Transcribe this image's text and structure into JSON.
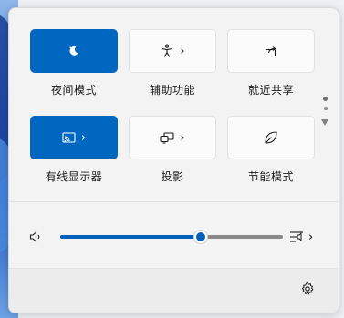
{
  "tiles": [
    {
      "label": "夜间模式",
      "state": "on",
      "icon": "night-light-icon"
    },
    {
      "label": "辅助功能",
      "state": "off",
      "icon": "accessibility-icon",
      "chevron": "›"
    },
    {
      "label": "就近共享",
      "state": "off",
      "icon": "nearby-share-icon"
    },
    {
      "label": "有线显示器",
      "state": "on",
      "icon": "cast-icon",
      "chevron": "›"
    },
    {
      "label": "投影",
      "state": "off",
      "icon": "project-icon",
      "chevron": "›"
    },
    {
      "label": "节能模式",
      "state": "off",
      "icon": "energy-saver-icon"
    }
  ],
  "volume": {
    "level": 0.63,
    "icon": "speaker-icon",
    "mixer_icon": "sound-output-icon",
    "mixer_chevron": "›"
  },
  "pager": {
    "pages": 2,
    "current": 1
  },
  "footer": {
    "settings_icon": "gear-icon"
  },
  "colors": {
    "accent": "#0067c0",
    "panel_bg": "#f3f3f3"
  }
}
